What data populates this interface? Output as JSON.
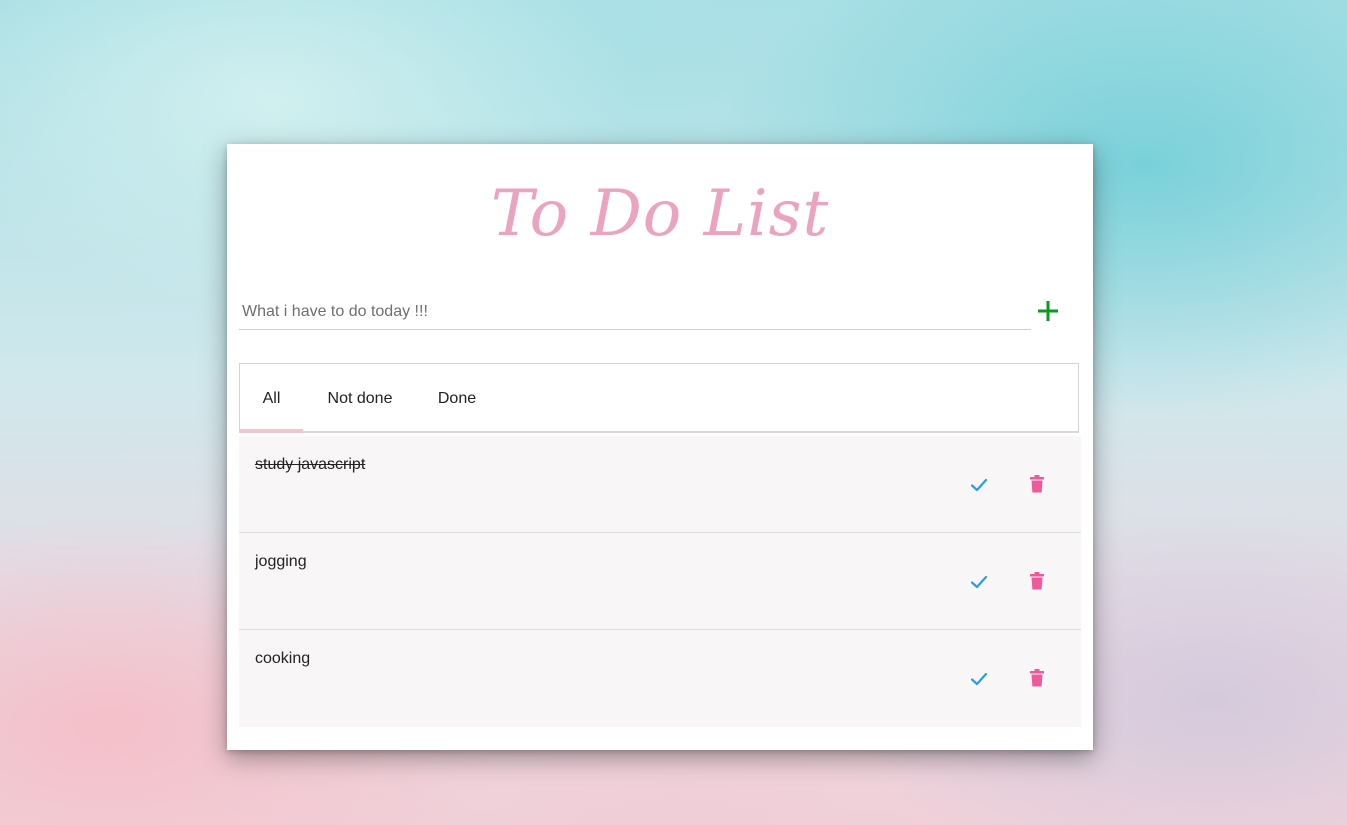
{
  "app": {
    "title": "To Do List"
  },
  "input": {
    "placeholder": "What i have to do today !!!",
    "value": ""
  },
  "add_button": {
    "icon": "plus-icon",
    "color": "#0a9a1e"
  },
  "tabs": [
    {
      "label": "All",
      "active": true
    },
    {
      "label": "Not done",
      "active": false
    },
    {
      "label": "Done",
      "active": false
    }
  ],
  "tasks": [
    {
      "text": "study javascript",
      "done": true
    },
    {
      "text": "jogging",
      "done": false
    },
    {
      "text": "cooking",
      "done": false
    }
  ],
  "icons": {
    "check": "check-icon",
    "delete": "trash-icon"
  },
  "colors": {
    "title": "#eba3c0",
    "check": "#2e9be6",
    "trash": "#ef5a9a",
    "tab_indicator": "#f5c5cf"
  }
}
